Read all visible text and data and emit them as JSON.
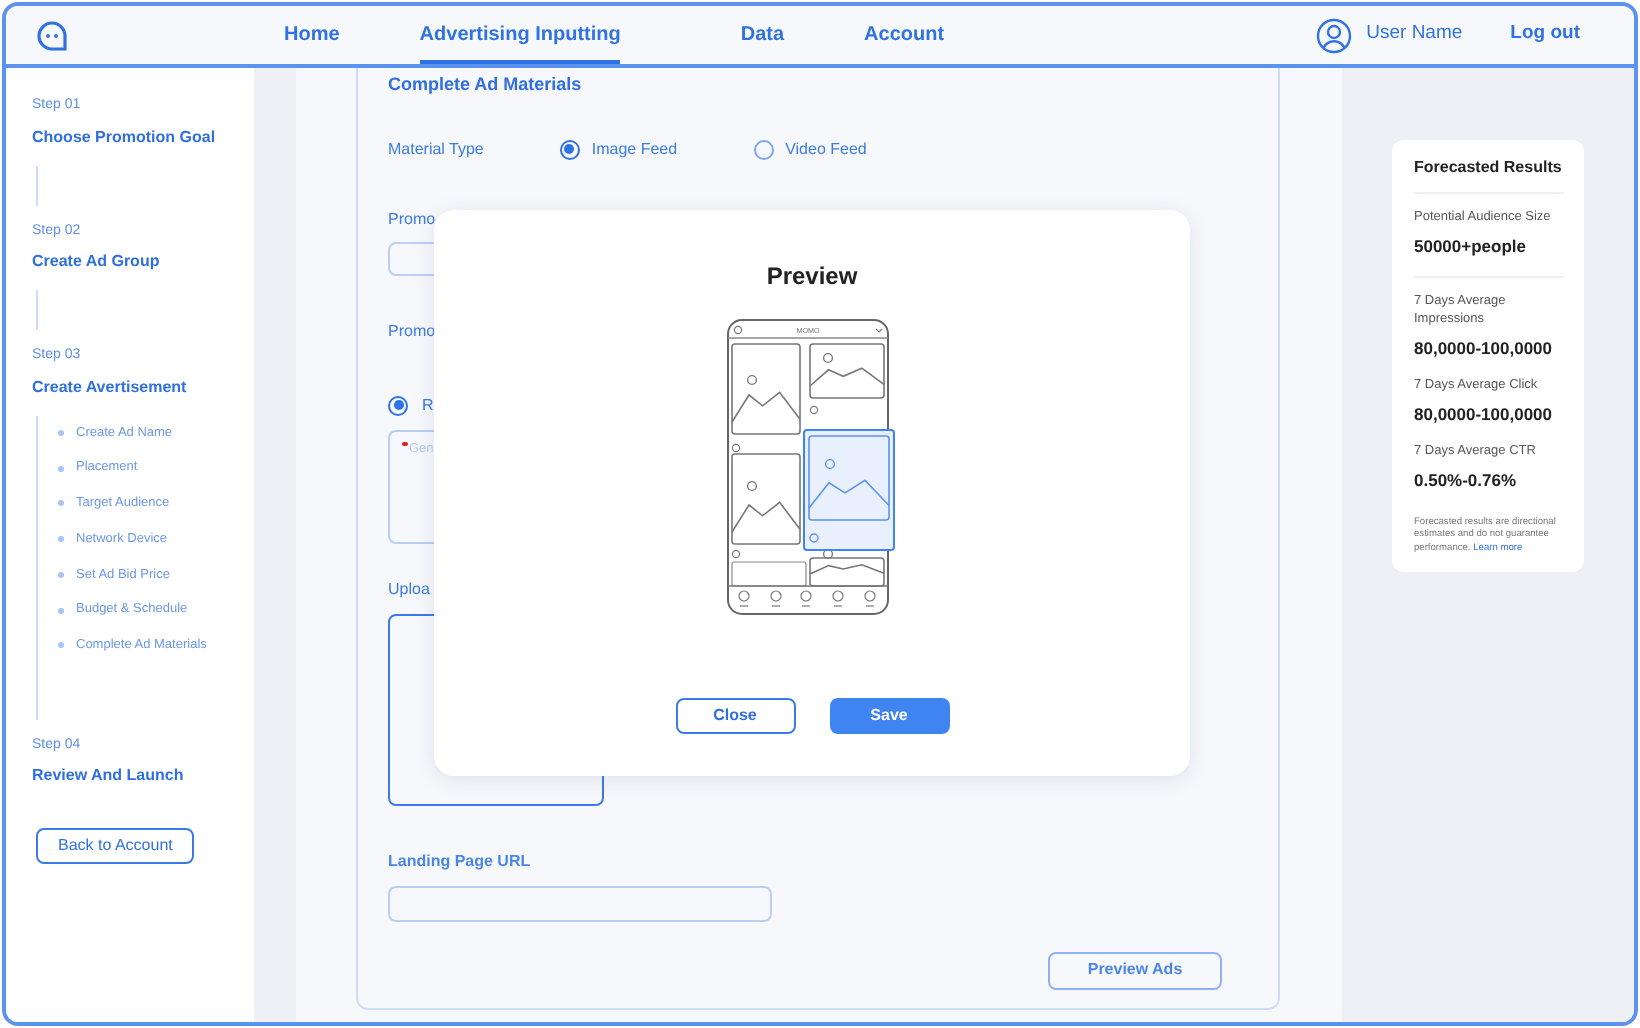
{
  "nav": {
    "items": [
      {
        "label": "Home",
        "selected": false
      },
      {
        "label": "Advertising Inputting",
        "selected": true
      },
      {
        "label": "Data",
        "selected": false
      },
      {
        "label": "Account",
        "selected": false
      }
    ],
    "user_name": "User Name",
    "logout": "Log out"
  },
  "sidebar": {
    "steps": [
      {
        "label": "Step 01",
        "title": "Choose Promotion Goal"
      },
      {
        "label": "Step 02",
        "title": "Create Ad Group"
      },
      {
        "label": "Step 03",
        "title": "Create Avertisement",
        "substeps": [
          "Create Ad Name",
          "Placement",
          "Target Audience",
          "Network Device",
          "Set Ad Bid Price",
          "Budget & Schedule",
          "Complete Ad Materials"
        ]
      },
      {
        "label": "Step 04",
        "title": "Review And Launch"
      }
    ],
    "back_button": "Back to Account"
  },
  "form": {
    "title": "Complete Ad Materials",
    "material_type": {
      "label": "Material Type",
      "options": [
        {
          "label": "Image Feed",
          "selected": true
        },
        {
          "label": "Video Feed",
          "selected": false
        }
      ]
    },
    "label_1": "Promo",
    "label_2": "Promo",
    "radio": {
      "label": "R",
      "selected": true
    },
    "text_area": {
      "required": true,
      "placeholder": "Gen"
    },
    "upload_label": "Uploa",
    "landing_label": "Landing Page URL",
    "preview_button": "Preview Ads"
  },
  "modal": {
    "title": "Preview",
    "app_title": "MOMO",
    "buttons": [
      {
        "label": "Close",
        "kind": "secondary"
      },
      {
        "label": "Save",
        "kind": "primary"
      }
    ]
  },
  "forecast": {
    "title": "Forecasted Results",
    "metrics": [
      {
        "label": "Potential Audience Size",
        "value": "50000+people"
      },
      {
        "label": "7 Days Average Impressions",
        "value": "80,0000-100,0000"
      },
      {
        "label": "7 Days Average Click",
        "value": "80,0000-100,0000"
      },
      {
        "label": "7 Days Average CTR",
        "value": "0.50%-0.76%"
      }
    ],
    "note": "Forecasted results are directional estimates and do not guarantee performance.",
    "link": "Learn more"
  }
}
